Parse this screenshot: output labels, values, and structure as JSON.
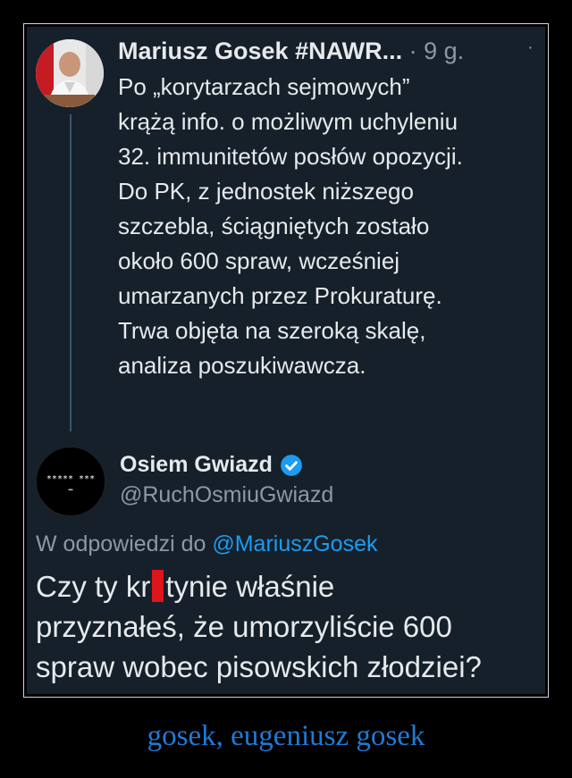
{
  "tweet": {
    "author_name": "Mariusz Gosek #NAWR...",
    "separator": "·",
    "time": "9 g.",
    "more": "·",
    "lines": [
      "Po „korytarzach sejmowych”",
      "krążą info. o możliwym uchyleniu",
      "32. immunitetów posłów opozycji.",
      "Do PK, z jednostek niższego",
      "szczebla, ściągniętych zostało",
      "około 600 spraw, wcześniej",
      "umarzanych przez Prokuraturę.",
      "Trwa objęta na szeroką skalę,",
      "analiza poszukiwawcza."
    ]
  },
  "reply": {
    "avatar_text": "***** ***",
    "display_name": "Osiem Gwiazd",
    "handle": "@RuchOsmiuGwiazd",
    "in_reply_prefix": "W odpowiedzi do",
    "in_reply_mention": "@MariuszGosek",
    "line1_before": "Czy ty kr",
    "line1_after": "tynie właśnie",
    "line2": "przyznałeś, że umorzyliście 600",
    "line3": "spraw wobec pisowskich złodziei?"
  },
  "colors": {
    "background": "#15202b",
    "mention": "#1d9bf0",
    "verified_badge": "#1d9bf0",
    "censor_bar": "#e0141b",
    "caption": "#1e7bd8"
  },
  "caption": "gosek, eugeniusz gosek"
}
